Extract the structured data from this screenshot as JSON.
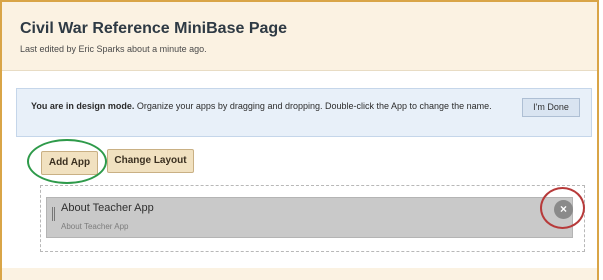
{
  "header": {
    "title": "Civil War Reference MiniBase Page",
    "last_edited": "Last edited by Eric Sparks about a minute ago."
  },
  "notice": {
    "bold_text": "You are in design mode.",
    "text": " Organize your apps by dragging and dropping. Double-click the App to change the name.",
    "done_label": "I'm Done"
  },
  "toolbar": {
    "add_app_label": "Add App",
    "change_layout_label": "Change Layout"
  },
  "apps": [
    {
      "title": "About Teacher App",
      "subtitle": "About Teacher App",
      "close_symbol": "×"
    }
  ],
  "colors": {
    "frame": "#d9a547",
    "header_bg": "#fbf2e2",
    "notice_bg": "#e8f0f9",
    "button_bg": "#f1e1c0",
    "highlight_green": "#2e9a4a",
    "highlight_red": "#b73a3a"
  }
}
